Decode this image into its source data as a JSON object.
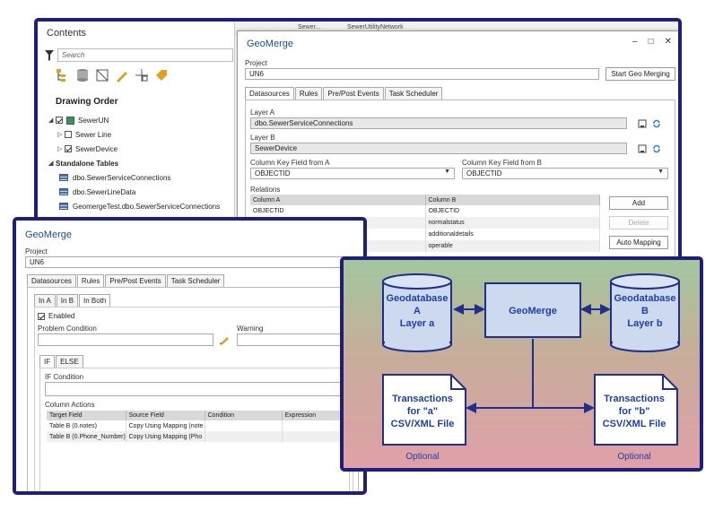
{
  "contents": {
    "title": "Contents",
    "search_placeholder": "Search",
    "drawing_order": "Drawing Order",
    "tree": [
      {
        "label": "SewerUN",
        "kind": "group",
        "checked": true
      },
      {
        "label": "Sewer Line",
        "kind": "layer",
        "checked": false
      },
      {
        "label": "SewerDevice",
        "kind": "layer",
        "checked": true
      },
      {
        "label": "Standalone Tables",
        "kind": "section"
      },
      {
        "label": "dbo.SewerServiceConnections",
        "kind": "table"
      },
      {
        "label": "dbo.SewerLineData",
        "kind": "table"
      },
      {
        "label": "GeomergeTest.dbo.SewerServiceConnections",
        "kind": "table"
      }
    ]
  },
  "background_tabs": [
    "Sewer...",
    "SewerUtilityNetwork"
  ],
  "geomerge_main": {
    "title": "GeoMerge",
    "project_label": "Project",
    "project_value": "UN6",
    "start_button": "Start Geo Merging",
    "tabs": [
      "Datasources",
      "Rules",
      "Pre/Post Events",
      "Task Scheduler"
    ],
    "active_tab": "Datasources",
    "layer_a_label": "Layer A",
    "layer_a_value": "dbo.SewerServiceConnections",
    "layer_b_label": "Layer B",
    "layer_b_value": "SewerDevice",
    "key_a_label": "Column Key Field from A",
    "key_a_value": "OBJECTID",
    "key_b_label": "Column Key Field from B",
    "key_b_value": "OBJECTID",
    "relations_label": "Relations",
    "relations_columns": [
      "Column A",
      "Column B"
    ],
    "relations_rows": [
      [
        "OBJECTID",
        "OBJECTID"
      ],
      [
        "",
        "normalstatus"
      ],
      [
        "",
        "additionaldetails"
      ],
      [
        "",
        "operable"
      ]
    ],
    "add_button": "Add",
    "delete_button": "Delete",
    "auto_mapping_button": "Auto Mapping"
  },
  "geomerge_rules": {
    "title": "GeoMerge",
    "project_label": "Project",
    "project_value": "UN6",
    "tabs": [
      "Datasources",
      "Rules",
      "Pre/Post Events",
      "Task Scheduler"
    ],
    "active_tab": "Rules",
    "sub_tabs": [
      "In A",
      "In B",
      "In Both"
    ],
    "active_sub_tab": "In Both",
    "enabled_label": "Enabled",
    "enabled": true,
    "problem_condition_label": "Problem Condition",
    "warning_label": "Warning",
    "branch_tabs": [
      "IF",
      "ELSE"
    ],
    "active_branch": "IF",
    "if_condition_label": "IF Condition",
    "column_actions_label": "Column Actions",
    "actions_columns": [
      "Target Field",
      "Source Field",
      "Condition",
      "Expression"
    ],
    "actions_rows": [
      [
        "Table B (0.notes)",
        "Copy Using Mapping (note",
        "",
        ""
      ],
      [
        "Table B (0.Phone_Number)",
        "Copy Using Mapping (Pho",
        "",
        ""
      ]
    ]
  },
  "diagram": {
    "db_a": [
      "Geodatabase",
      "A",
      "Layer a"
    ],
    "center": "GeoMerge",
    "db_b": [
      "Geodatabase",
      "B",
      "Layer b"
    ],
    "file_a": [
      "Transactions",
      "for \"a\"",
      "CSV/XML File"
    ],
    "file_b": [
      "Transactions",
      "for \"b\"",
      "CSV/XML File"
    ],
    "optional": "Optional",
    "colors": {
      "frame": "#1f1f7a",
      "shape_fill": "#cdd9ef",
      "text": "#1f3fa8",
      "line": "#1f2f8a"
    }
  }
}
